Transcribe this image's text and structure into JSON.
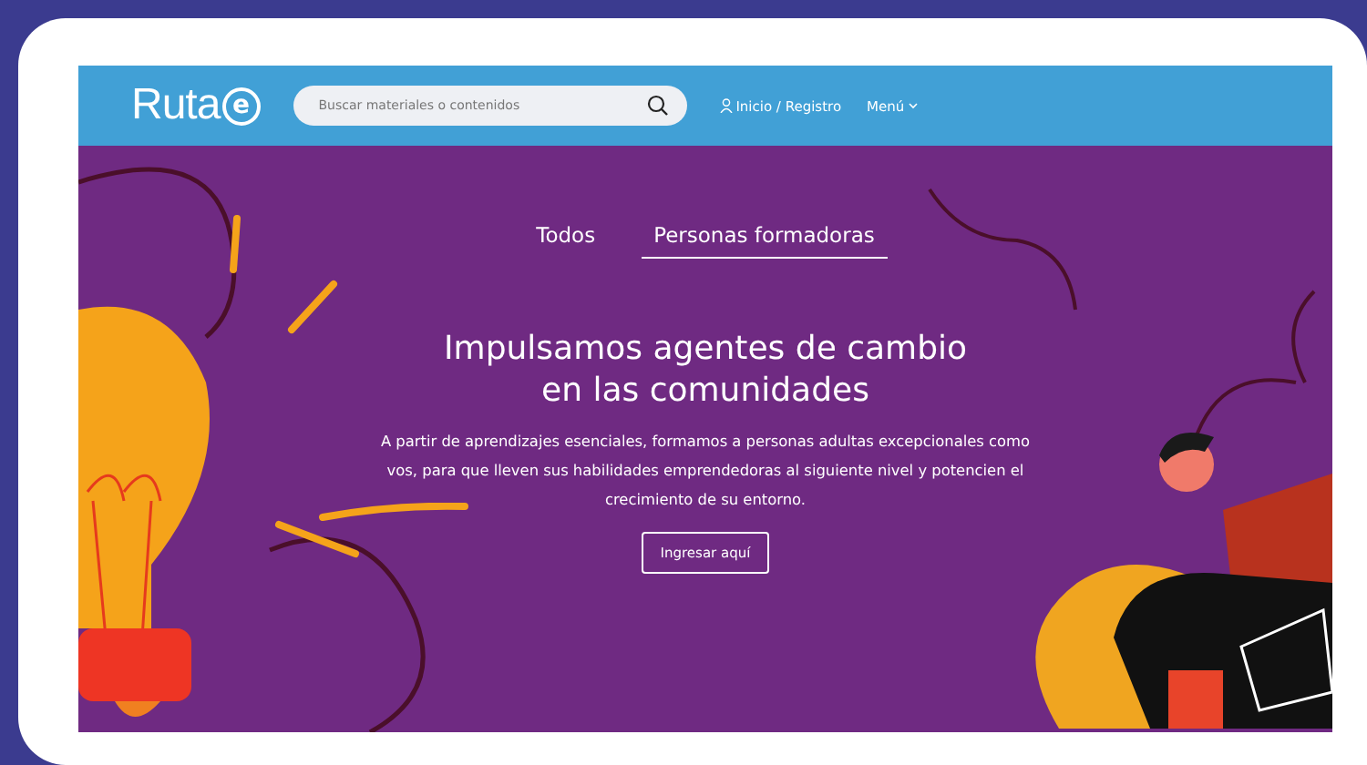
{
  "header": {
    "logo": {
      "text": "Ruta",
      "mark": "e"
    },
    "search": {
      "placeholder": "Buscar materiales o contenidos"
    },
    "login": "Inicio / Registro",
    "menu": "Menú"
  },
  "hero": {
    "tabs": [
      {
        "label": "Todos",
        "selected": false
      },
      {
        "label": "Personas formadoras",
        "selected": true
      }
    ],
    "headline": [
      "Impulsamos agentes de cambio",
      "en las comunidades"
    ],
    "description": "A partir de aprendizajes esenciales, formamos a personas adultas excepcionales como vos, para que lleven sus habilidades emprendedoras al siguiente nivel y potencien el crecimiento de su entorno.",
    "button": "Ingresar aquí"
  }
}
